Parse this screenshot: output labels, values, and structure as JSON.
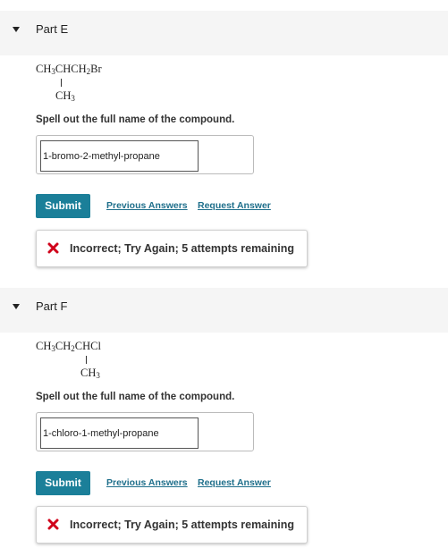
{
  "parts": [
    {
      "title": "Part E",
      "formula_main": [
        "CH",
        "3",
        "CHCH",
        "2",
        "Br"
      ],
      "formula_branch": [
        "CH",
        "3"
      ],
      "prompt": "Spell out the full name of the compound.",
      "answer_value": "1-bromo-2-methyl-propane",
      "submit_label": "Submit",
      "previous_answers_label": "Previous Answers",
      "request_answer_label": "Request Answer",
      "feedback_text": "Incorrect; Try Again; 5 attempts remaining"
    },
    {
      "title": "Part F",
      "formula_main": [
        "CH",
        "3",
        "CH",
        "2",
        "CHCl"
      ],
      "formula_branch": [
        "CH",
        "3"
      ],
      "prompt": "Spell out the full name of the compound.",
      "answer_value": "1-chloro-1-methyl-propane",
      "submit_label": "Submit",
      "previous_answers_label": "Previous Answers",
      "request_answer_label": "Request Answer",
      "feedback_text": "Incorrect; Try Again; 5 attempts remaining"
    }
  ],
  "colors": {
    "header_bg": "#f5f5f5",
    "submit_bg": "#1b7f99",
    "link": "#1f6f8b",
    "error_icon": "#d0021b"
  },
  "icons": {
    "collapse": "caret-down-icon",
    "incorrect": "x-mark-icon"
  }
}
